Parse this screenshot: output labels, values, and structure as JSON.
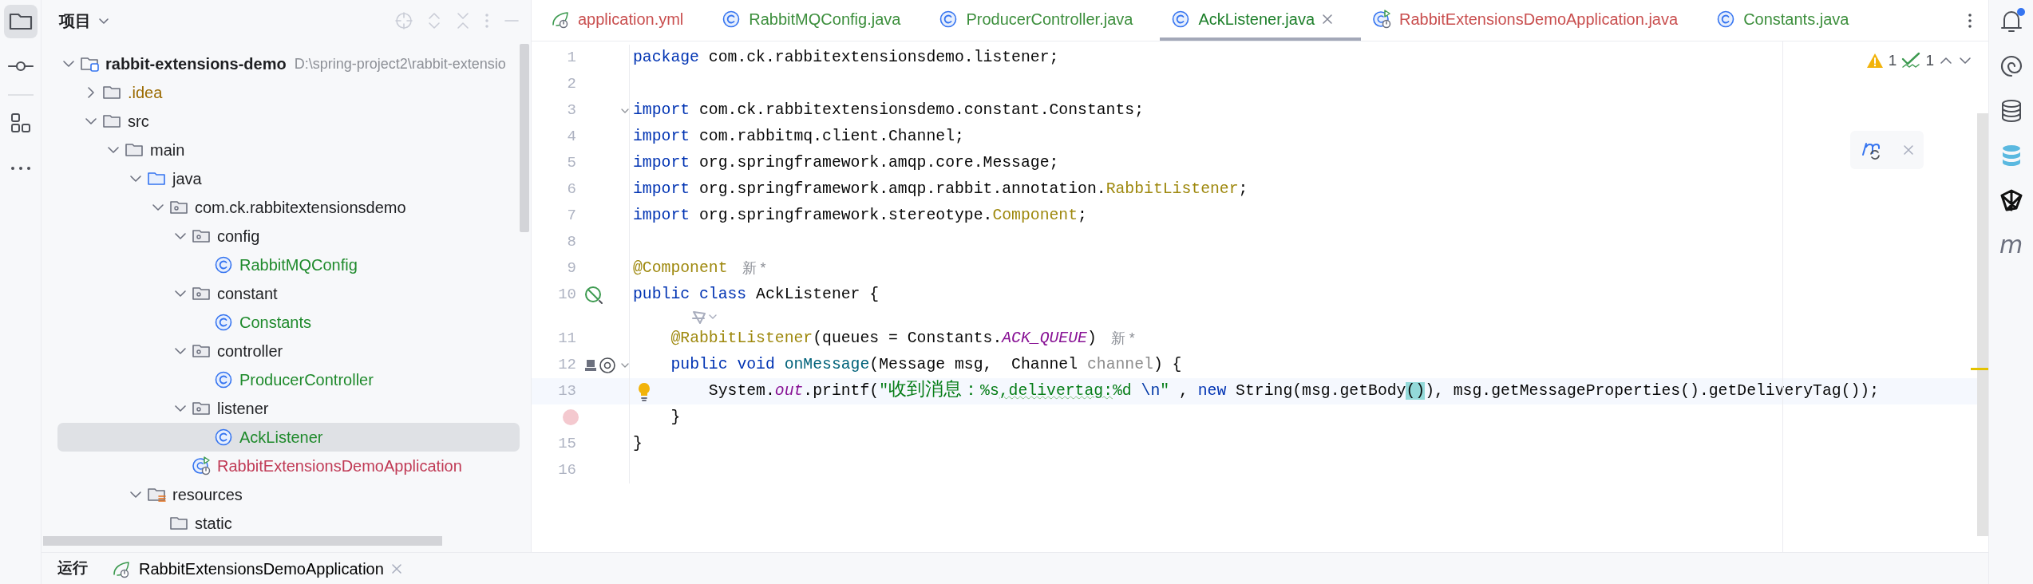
{
  "tool_strip_left": [
    {
      "kind": "project",
      "selected": true
    },
    {
      "kind": "commit",
      "selected": false
    },
    {
      "kind": "structure",
      "selected": false
    },
    {
      "kind": "more",
      "selected": false
    }
  ],
  "project_panel": {
    "title": "项目",
    "tree": [
      {
        "label": "rabbit-extensions-demo",
        "path": "D:\\spring-project2\\rabbit-extensio",
        "kind": "module",
        "expanded": true,
        "selected": false,
        "children": [
          {
            "label": ".idea",
            "kind": "folder",
            "expanded": false,
            "selected": false,
            "color": "#9a6a00"
          },
          {
            "label": "src",
            "kind": "folder",
            "expanded": true,
            "selected": false,
            "children": [
              {
                "label": "main",
                "kind": "folder",
                "expanded": true,
                "selected": false,
                "children": [
                  {
                    "label": "java",
                    "kind": "source",
                    "expanded": true,
                    "selected": false,
                    "children": [
                      {
                        "label": "com.ck.rabbitextensionsdemo",
                        "kind": "package",
                        "expanded": true,
                        "selected": false,
                        "children": [
                          {
                            "label": "config",
                            "kind": "package",
                            "expanded": true,
                            "selected": false,
                            "children": [
                              {
                                "label": "RabbitMQConfig",
                                "kind": "class",
                                "selected": false,
                                "color": "#1f8a2c"
                              }
                            ]
                          },
                          {
                            "label": "constant",
                            "kind": "package",
                            "expanded": true,
                            "selected": false,
                            "children": [
                              {
                                "label": "Constants",
                                "kind": "class",
                                "selected": false,
                                "color": "#1f8a2c"
                              }
                            ]
                          },
                          {
                            "label": "controller",
                            "kind": "package",
                            "expanded": true,
                            "selected": false,
                            "children": [
                              {
                                "label": "ProducerController",
                                "kind": "class",
                                "selected": false,
                                "color": "#1f8a2c"
                              }
                            ]
                          },
                          {
                            "label": "listener",
                            "kind": "package",
                            "expanded": true,
                            "selected": false,
                            "children": [
                              {
                                "label": "AckListener",
                                "kind": "class",
                                "selected": true,
                                "color": "#1f8a2c"
                              }
                            ]
                          },
                          {
                            "label": "RabbitExtensionsDemoApplication",
                            "kind": "app",
                            "selected": false,
                            "color": "#c03a55"
                          }
                        ]
                      }
                    ]
                  },
                  {
                    "label": "resources",
                    "kind": "resources",
                    "expanded": true,
                    "selected": false,
                    "children": [
                      {
                        "label": "static",
                        "kind": "folder",
                        "selected": false
                      }
                    ]
                  }
                ]
              }
            ]
          }
        ]
      }
    ]
  },
  "tabs": [
    {
      "label": "application.yml",
      "kind": "yml",
      "selected": false,
      "color": "#c94f4f"
    },
    {
      "label": "RabbitMQConfig.java",
      "kind": "class",
      "selected": false,
      "color": "#3d8f3d"
    },
    {
      "label": "ProducerController.java",
      "kind": "class",
      "selected": false,
      "color": "#3d8f3d"
    },
    {
      "label": "AckListener.java",
      "kind": "class",
      "selected": true,
      "color": "#1d7f2a"
    },
    {
      "label": "RabbitExtensionsDemoApplication.java",
      "kind": "app",
      "selected": false,
      "color": "#c94f4f"
    },
    {
      "label": "Constants.java",
      "kind": "class",
      "selected": false,
      "color": "#3d8f3d"
    }
  ],
  "inspections": {
    "warnings": "1",
    "weak_warnings": "1"
  },
  "editor_lines": [
    {
      "kind": "code",
      "number": "1",
      "current": false,
      "tokens": [
        {
          "kind": "keyword",
          "text": "package"
        },
        {
          "kind": "plain",
          "text": " com.ck.rabbitextensionsdemo.listener;"
        }
      ]
    },
    {
      "kind": "code",
      "number": "2",
      "current": false
    },
    {
      "kind": "code",
      "number": "3",
      "current": false,
      "gutter": [
        {
          "kind": "fold"
        }
      ],
      "tokens": [
        {
          "kind": "keyword",
          "text": "import"
        },
        {
          "kind": "plain",
          "text": " com.ck.rabbitextensionsdemo.constant.Constants;"
        }
      ]
    },
    {
      "kind": "code",
      "number": "4",
      "current": false,
      "tokens": [
        {
          "kind": "keyword",
          "text": "import"
        },
        {
          "kind": "plain",
          "text": " com.rabbitmq.client.Channel;"
        }
      ]
    },
    {
      "kind": "code",
      "number": "5",
      "current": false,
      "tokens": [
        {
          "kind": "keyword",
          "text": "import"
        },
        {
          "kind": "plain",
          "text": " org.springframework.amqp.core.Message;"
        }
      ]
    },
    {
      "kind": "code",
      "number": "6",
      "current": false,
      "tokens": [
        {
          "kind": "keyword",
          "text": "import"
        },
        {
          "kind": "plain",
          "text": " org.springframework.amqp.rabbit.annotation."
        },
        {
          "kind": "annotation",
          "text": "RabbitListener"
        },
        {
          "kind": "plain",
          "text": ";"
        }
      ]
    },
    {
      "kind": "code",
      "number": "7",
      "current": false,
      "tokens": [
        {
          "kind": "keyword",
          "text": "import"
        },
        {
          "kind": "plain",
          "text": " org.springframework.stereotype."
        },
        {
          "kind": "annotation",
          "text": "Component"
        },
        {
          "kind": "plain",
          "text": ";"
        }
      ]
    },
    {
      "kind": "code",
      "number": "8",
      "current": false
    },
    {
      "kind": "code",
      "number": "9",
      "current": false,
      "hint": "新 *",
      "tokens": [
        {
          "kind": "annotation",
          "text": "@Component"
        }
      ]
    },
    {
      "kind": "code",
      "number": "10",
      "current": false,
      "gutter": [
        {
          "kind": "bean"
        }
      ],
      "tokens": [
        {
          "kind": "keyword",
          "text": "public class"
        },
        {
          "kind": "plain",
          "text": " AckListener {"
        }
      ]
    },
    {
      "kind": "inlay"
    },
    {
      "kind": "code",
      "number": "11",
      "current": false,
      "hint": "新 *",
      "tokens": [
        {
          "kind": "annotation",
          "text": "    @RabbitListener"
        },
        {
          "kind": "plain",
          "text": "(queues = Constants."
        },
        {
          "kind": "constant",
          "text": "ACK_QUEUE"
        },
        {
          "kind": "plain",
          "text": ")"
        }
      ]
    },
    {
      "kind": "code",
      "number": "12",
      "current": false,
      "gutter": [
        {
          "kind": "implements"
        },
        {
          "kind": "fold"
        }
      ],
      "tokens": [
        {
          "kind": "keyword",
          "text": "    public void "
        },
        {
          "kind": "method",
          "text": "onMessage"
        },
        {
          "kind": "plain",
          "text": "(Message msg,  Channel "
        },
        {
          "kind": "unused",
          "text": "channel"
        },
        {
          "kind": "plain",
          "text": ") {"
        }
      ]
    },
    {
      "kind": "code",
      "number": "13",
      "current": true,
      "gutter": [
        {
          "kind": "bulb"
        }
      ],
      "tokens": [
        {
          "kind": "plain",
          "text": "        System."
        },
        {
          "kind": "static",
          "text": "out"
        },
        {
          "kind": "plain",
          "text": ".printf("
        },
        {
          "kind": "string",
          "text": "\"收到消息：%s"
        },
        {
          "kind": "typo",
          "text": ",delivertag:"
        },
        {
          "kind": "string",
          "text": "%d "
        },
        {
          "kind": "escape",
          "text": "\\n"
        },
        {
          "kind": "string",
          "text": "\""
        },
        {
          "kind": "plain",
          "text": " , "
        },
        {
          "kind": "keyword",
          "text": "new"
        },
        {
          "kind": "plain",
          "text": " String(msg.getBody"
        },
        {
          "kind": "match",
          "text": "()"
        },
        {
          "kind": "plain",
          "text": "), msg.getMessageProperties().getDeliveryTag());"
        }
      ]
    },
    {
      "kind": "code",
      "current": false,
      "breakpoint": true,
      "tokens": [
        {
          "kind": "plain",
          "text": "    }"
        }
      ]
    },
    {
      "kind": "code",
      "number": "15",
      "current": false,
      "tokens": [
        {
          "kind": "plain",
          "text": "}"
        }
      ]
    },
    {
      "kind": "code",
      "number": "16",
      "current": false
    }
  ],
  "run_panel": {
    "title": "运行",
    "tab": "RabbitExtensionsDemoApplication"
  },
  "tool_strip_right": [
    {
      "kind": "notifications",
      "badge": true
    },
    {
      "kind": "ai"
    },
    {
      "kind": "database"
    },
    {
      "kind": "redis"
    },
    {
      "kind": "plugin"
    },
    {
      "kind": "maven",
      "glyph": "m"
    }
  ]
}
